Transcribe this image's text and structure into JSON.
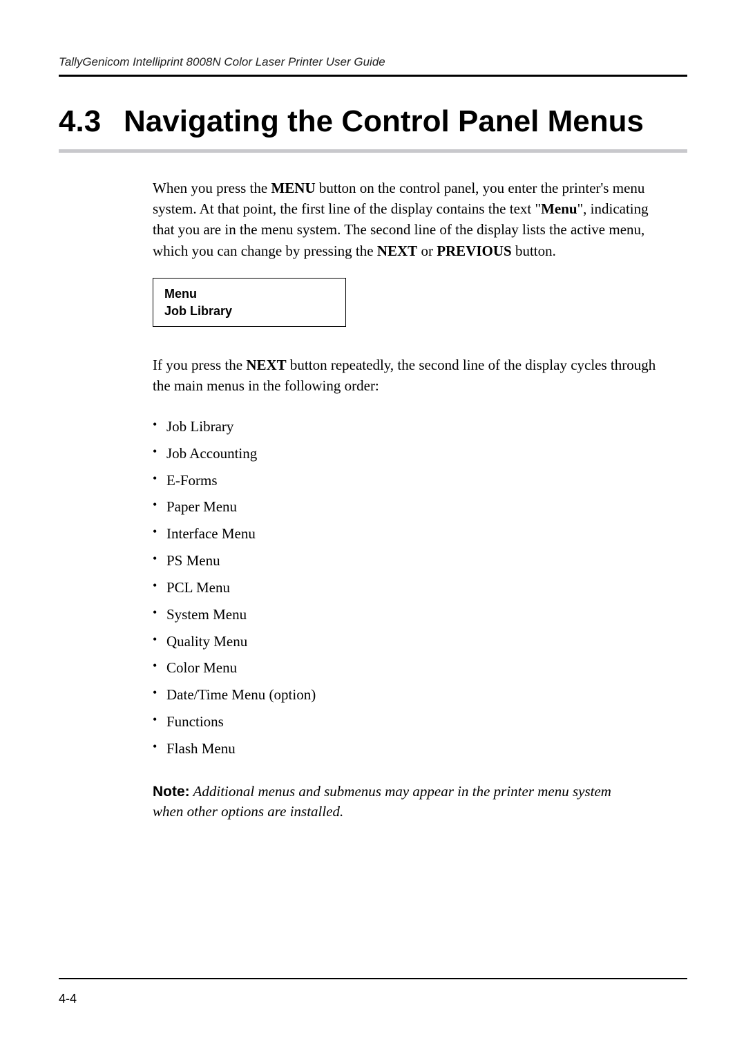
{
  "header": {
    "running_title": "TallyGenicom Intelliprint 8008N Color Laser Printer User Guide"
  },
  "section": {
    "number": "4.3",
    "title": "Navigating the Control Panel Menus"
  },
  "intro": {
    "p1_pre": "When you press the ",
    "p1_b1": "MENU",
    "p1_mid1": " button on the control panel, you enter the printer's menu system. At that point, the first line of the display contains the text \"",
    "p1_b2": "Menu",
    "p1_mid2": "\", indicating that you are in the menu system. The second line of the display lists the active menu, which you can change by pressing the ",
    "p1_b3": "NEXT",
    "p1_mid3": " or ",
    "p1_b4": "PREVIOUS",
    "p1_end": " button."
  },
  "display_box": {
    "line1": "Menu",
    "line2": "Job Library"
  },
  "after_box": {
    "p2_pre": "If you press the ",
    "p2_b1": "NEXT",
    "p2_end": " button repeatedly, the second line of the display cycles through the main menus in the following order:"
  },
  "menus": [
    "Job Library",
    "Job Accounting",
    "E-Forms",
    "Paper Menu",
    "Interface Menu",
    "PS Menu",
    "PCL Menu",
    "System Menu",
    "Quality Menu",
    "Color Menu",
    "Date/Time Menu (option)",
    "Functions",
    "Flash Menu"
  ],
  "note": {
    "label": "Note:",
    "text": "  Additional menus and submenus may appear in the printer menu system when other options are installed."
  },
  "footer": {
    "page": "4-4"
  }
}
